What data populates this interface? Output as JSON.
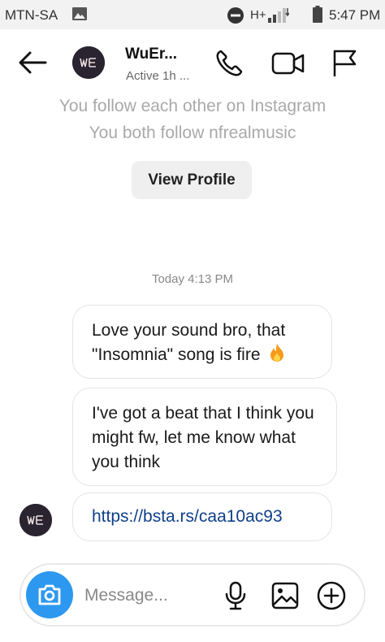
{
  "status_bar": {
    "carrier": "MTN-SA",
    "network": "H+",
    "time": "5:47 PM",
    "icons": [
      "image-icon",
      "dnd-icon",
      "signal-icon",
      "battery-icon"
    ]
  },
  "header": {
    "back_icon": "arrow-left-icon",
    "name": "WuEr...",
    "status": "Active 1h ...",
    "actions": [
      "phone-icon",
      "video-camera-icon",
      "flag-icon"
    ]
  },
  "info": {
    "line1": "You follow each other on Instagram",
    "line2": "You both follow nfrealmusic"
  },
  "view_profile_label": "View Profile",
  "timestamp": "Today 4:13 PM",
  "messages": [
    {
      "text": "Love your sound bro, that \"Insomnia\" song is fire",
      "emoji": "fire-emoji"
    },
    {
      "text": "I've got a beat that I think you might fw, let me know what you think"
    },
    {
      "link": "https://bsta.rs/caa10ac93"
    }
  ],
  "composer": {
    "placeholder": "Message...",
    "camera_icon": "camera-icon",
    "icons": [
      "microphone-icon",
      "gallery-icon",
      "add-icon"
    ]
  },
  "colors": {
    "camera_button": "#2d98ef",
    "link": "#0f3f8a",
    "info_text": "#a9a9a9",
    "avatar_bg": "#2a2330",
    "fire": "#f59a1a"
  }
}
